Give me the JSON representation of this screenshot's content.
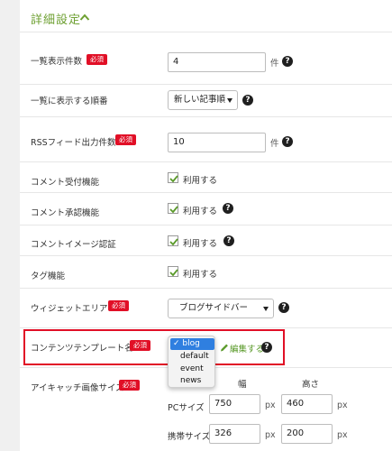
{
  "section": {
    "title": "詳細設定"
  },
  "settings": {
    "list_count": {
      "label": "一覧表示件数",
      "required": "必須",
      "value": "4",
      "unit": "件"
    },
    "list_order": {
      "label": "一覧に表示する順番",
      "value": "新しい記事順"
    },
    "rss_count": {
      "label": "RSSフィード出力件数",
      "required": "必須",
      "value": "10",
      "unit": "件"
    },
    "comment_accept": {
      "label": "コメント受付機能",
      "checkbox_label": "利用する",
      "checked": true
    },
    "comment_approval": {
      "label": "コメント承認機能",
      "checkbox_label": "利用する",
      "checked": true
    },
    "comment_image_auth": {
      "label": "コメントイメージ認証",
      "checkbox_label": "利用する",
      "checked": true
    },
    "tag": {
      "label": "タグ機能",
      "checkbox_label": "利用する",
      "checked": true
    },
    "widget_area": {
      "label": "ウィジェットエリア",
      "required": "必須",
      "value": "ブログサイドバー"
    },
    "content_template": {
      "label": "コンテンツテンプレート名",
      "required": "必須",
      "options": [
        "blog",
        "default",
        "event",
        "news"
      ],
      "selected": "blog",
      "edit_label": "編集する"
    },
    "eyecatch": {
      "label": "アイキャッチ画像サイズ",
      "required": "必須",
      "width_header": "幅",
      "height_header": "高さ",
      "pc_label": "PCサイズ",
      "pc_width": "750",
      "pc_height": "460",
      "mobile_label": "携帯サイズ",
      "mobile_width": "326",
      "mobile_height": "200",
      "unit": "px"
    }
  },
  "colors": {
    "accent": "#6ea032",
    "required_badge": "#e10f26",
    "highlight": "#e10f26",
    "selected_option": "#2f7fe0"
  }
}
